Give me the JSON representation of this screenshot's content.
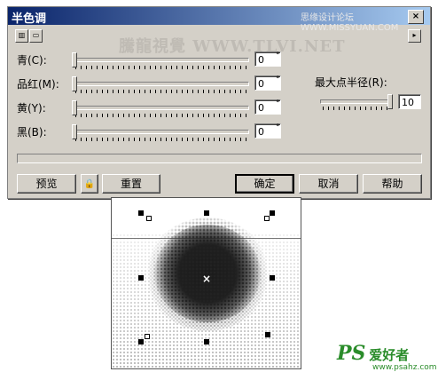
{
  "dialog": {
    "title": "半色调",
    "header_watermark": "思缘设计论坛 WWW.MISSYUAN.COM",
    "title_close": "×",
    "menu_arrow": "▸",
    "view_buttons": [
      "▥",
      "▭"
    ],
    "watermark": "騰龍視覺 WWW.TLVI.NET",
    "channels": [
      {
        "label": "青(C):",
        "value": "0",
        "unit": "°",
        "level": 0
      },
      {
        "label": "品红(M):",
        "value": "0",
        "unit": "°",
        "level": 0
      },
      {
        "label": "黄(Y):",
        "value": "0",
        "unit": "°",
        "level": 0
      },
      {
        "label": "黑(B):",
        "value": "0",
        "unit": "°",
        "level": 0
      }
    ],
    "radius": {
      "label": "最大点半径(R):",
      "value": "10",
      "level": 1.0
    },
    "buttons": {
      "preview": "预览",
      "lock": "🔒",
      "reset": "重置",
      "ok": "确定",
      "cancel": "取消",
      "help": "帮助"
    }
  },
  "logo": {
    "brand": "PS",
    "cn": "爱好者",
    "url": "www.psahz.com"
  }
}
